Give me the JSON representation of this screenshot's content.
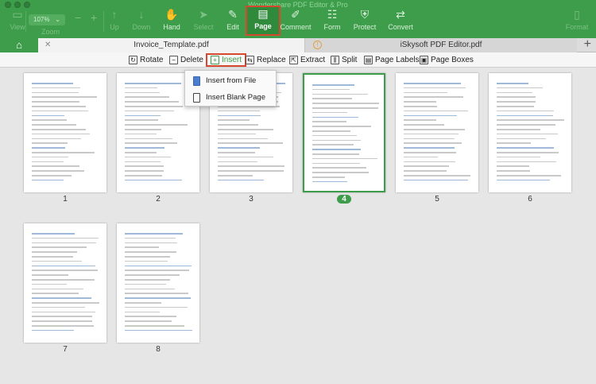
{
  "app": {
    "title": "Wondershare PDF Editor & Pro",
    "zoom": "107%"
  },
  "toolbar": {
    "view": "View",
    "zoom": "Zoom",
    "up": "Up",
    "down": "Down",
    "hand": "Hand",
    "select": "Select",
    "edit": "Edit",
    "page": "Page",
    "comment": "Comment",
    "form": "Form",
    "protect": "Protect",
    "convert": "Convert",
    "format": "Format"
  },
  "tabs": [
    {
      "label": "Invoice_Template.pdf"
    },
    {
      "label": "iSkysoft PDF Editor.pdf"
    }
  ],
  "page_tools": {
    "rotate": "Rotate",
    "delete": "Delete",
    "insert": "Insert",
    "replace": "Replace",
    "extract": "Extract",
    "split": "Split",
    "page_labels": "Page Labels",
    "page_boxes": "Page Boxes"
  },
  "insert_menu": {
    "from_file": "Insert from File",
    "blank_page": "Insert Blank Page"
  },
  "pages": [
    "1",
    "2",
    "3",
    "4",
    "5",
    "6",
    "7",
    "8"
  ],
  "selected_page": "4",
  "colors": {
    "accent": "#3e9d4a",
    "highlight": "#d6492f"
  }
}
